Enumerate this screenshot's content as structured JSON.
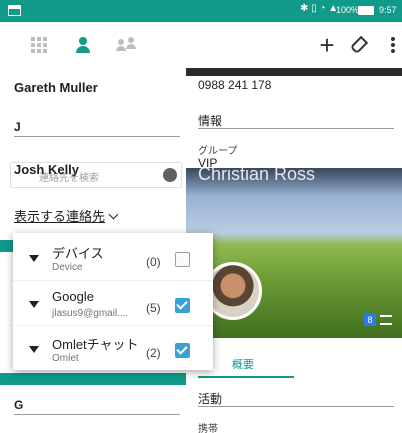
{
  "status_bar": {
    "battery_percent": "100%",
    "time": "9:57",
    "icons": [
      "app-notification-icon",
      "bluetooth-icon",
      "vibrate-icon",
      "wifi-icon",
      "no-signal-icon",
      "battery-icon"
    ],
    "color": "#0f9a8a"
  },
  "app_bar": {
    "tabs": [
      "grid-icon",
      "person-icon",
      "group-icon"
    ],
    "active_tab": "person-icon",
    "actions": [
      "plus-icon",
      "edit-icon",
      "more-icon"
    ]
  },
  "contact_list": {
    "entries": [
      {
        "type": "name",
        "text": "Gareth Muller"
      },
      {
        "type": "section",
        "text": "J"
      },
      {
        "type": "name",
        "text": "Josh Kelly"
      },
      {
        "type": "section",
        "text": "G"
      }
    ],
    "search_placeholder": "連絡先を検索"
  },
  "filter": {
    "label": "表示する連絡先",
    "accounts": [
      {
        "title": "デバイス",
        "subtitle": "Device",
        "count": "(0)",
        "checked": false
      },
      {
        "title": "Google",
        "subtitle": "jlasus9@gmail....",
        "count": "(5)",
        "checked": true
      },
      {
        "title": "Omletチャット",
        "subtitle": "Omlet",
        "count": "(2)",
        "checked": true
      }
    ]
  },
  "detail": {
    "phone": "0988 241 178",
    "info_label": "情報",
    "group_caption": "グループ",
    "group_value": "VIP",
    "contact_name": "Christian Ross",
    "tab_summary": "概要",
    "activity_label": "活動",
    "mobile_caption": "携帯"
  },
  "colors": {
    "accent": "#0f9a8a",
    "checkbox": "#3aa0d8"
  }
}
